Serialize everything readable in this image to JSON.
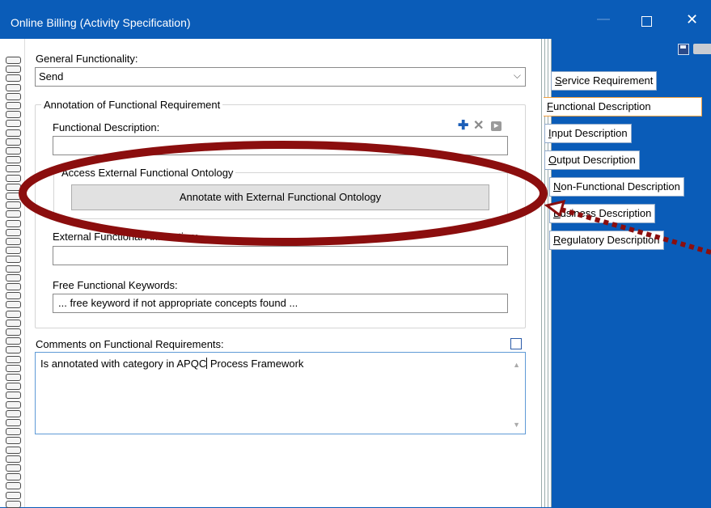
{
  "window": {
    "title": "Online Billing (Activity Specification)",
    "minimize_glyph": "—",
    "close_glyph": "✕"
  },
  "form": {
    "general_functionality": {
      "label": "General Functionality:",
      "value": "Send",
      "chevron": "⌵"
    },
    "annotation_group": {
      "legend": "Annotation of Functional Requirement",
      "functional_description_label": "Functional Description:",
      "functional_description_value": "",
      "external_ontology_group": {
        "legend": "Access External Functional Ontology",
        "button_label": "Annotate with External Functional Ontology"
      },
      "external_functional_label": "External Functional Annotation:",
      "external_functional_value": "",
      "free_keywords_label": "Free Functional Keywords:",
      "free_keywords_value": "... free keyword if not appropriate concepts found ..."
    },
    "comments": {
      "label": "Comments on Functional Requirements:",
      "value_before_caret": "Is annotated with category in APQC",
      "value_after_caret": " Process Framework"
    },
    "toolbar_icons": {
      "add": "add-icon",
      "delete": "delete-icon",
      "next": "next-icon",
      "plus_glyph": "✚",
      "x_glyph": "✕",
      "next_glyph": "▸"
    }
  },
  "tabs": [
    {
      "accel": "S",
      "rest": "ervice Requirement"
    },
    {
      "accel": "F",
      "rest": "unctional Description"
    },
    {
      "accel": "I",
      "rest": "nput Description"
    },
    {
      "accel": "O",
      "rest": "utput Description"
    },
    {
      "accel": "N",
      "rest": "on-Functional Description"
    },
    {
      "accel": "B",
      "rest": "usiness Description"
    },
    {
      "accel": "R",
      "rest": "egulatory Description"
    }
  ],
  "active_tab_index": 1,
  "colors": {
    "window_blue": "#0a5cb8",
    "annotation_red": "#8b0e0e",
    "active_tab_border": "#f0a040"
  }
}
